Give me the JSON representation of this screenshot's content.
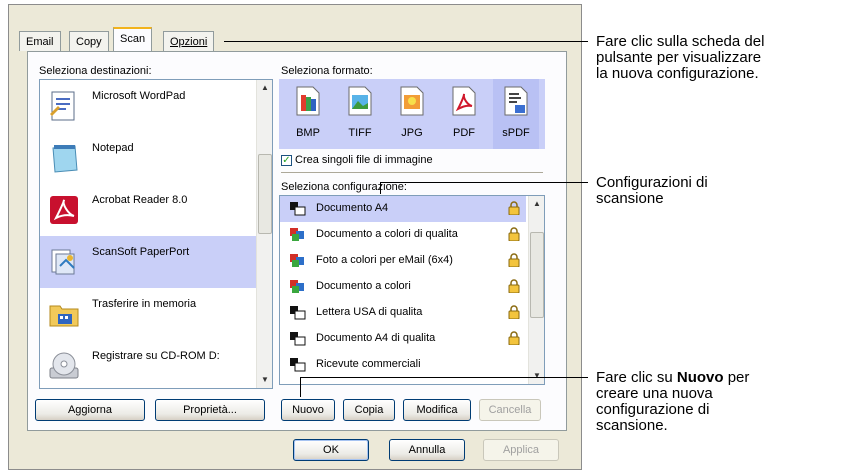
{
  "tabs": [
    {
      "label": "Email"
    },
    {
      "label": "Copy"
    },
    {
      "label": "Scan"
    },
    {
      "label": "Opzioni"
    }
  ],
  "destinations": {
    "heading": "Seleziona destinazioni:",
    "items": [
      {
        "label": "Microsoft WordPad",
        "icon": "wordpad-icon"
      },
      {
        "label": "Notepad",
        "icon": "notepad-icon"
      },
      {
        "label": "Acrobat Reader 8.0",
        "icon": "acrobat-icon"
      },
      {
        "label": "ScanSoft PaperPort",
        "icon": "paperport-icon"
      },
      {
        "label": "Trasferire in memoria",
        "icon": "folder-icon"
      },
      {
        "label": "Registrare su CD-ROM  D:",
        "icon": "cdrom-icon"
      }
    ],
    "selected": "ScanSoft PaperPort"
  },
  "formats": {
    "heading": "Seleziona formato:",
    "items": [
      {
        "label": "BMP",
        "icon": "bmp-icon"
      },
      {
        "label": "TIFF",
        "icon": "tiff-icon"
      },
      {
        "label": "JPG",
        "icon": "jpg-icon"
      },
      {
        "label": "PDF",
        "icon": "pdf-icon"
      },
      {
        "label": "sPDF",
        "icon": "spdf-icon"
      }
    ],
    "selected": "sPDF",
    "checkbox_label": "Crea singoli file di immagine",
    "checkbox_checked": true
  },
  "configs": {
    "heading": "Seleziona configurazione:",
    "items": [
      {
        "label": "Documento A4",
        "icon": "bw-document-icon"
      },
      {
        "label": "Documento a colori di qualita",
        "icon": "color-document-icon"
      },
      {
        "label": "Foto a colori per eMail (6x4)",
        "icon": "color-document-icon"
      },
      {
        "label": "Documento a colori",
        "icon": "color-document-icon"
      },
      {
        "label": "Lettera USA di qualita",
        "icon": "bw-document-icon"
      },
      {
        "label": "Documento A4 di qualita",
        "icon": "bw-document-icon"
      },
      {
        "label": "Ricevute commerciali",
        "icon": "bw-document-icon"
      }
    ],
    "selected": "Documento A4"
  },
  "buttons": {
    "refresh": "Aggiorna",
    "properties": "Proprietà...",
    "new": "Nuovo",
    "copy": "Copia",
    "edit": "Modifica",
    "delete": "Cancella",
    "ok": "OK",
    "cancel": "Annulla",
    "apply": "Applica"
  },
  "annotations": {
    "tab_note": [
      "Fare clic sulla scheda del",
      "pulsante per visualizzare",
      "la nuova configurazione."
    ],
    "config_note": [
      "Configurazioni di",
      "scansione"
    ],
    "new_note_prefix": "Fare clic su ",
    "new_note_bold": "Nuovo",
    "new_note_suffix": " per",
    "new_note_rest": [
      "creare una nuova",
      "configurazione di",
      "scansione."
    ]
  },
  "colors": {
    "selection": "#c9cff8",
    "dialog_bg": "#ece9d8",
    "tab_highlight": "#f2b31c"
  }
}
